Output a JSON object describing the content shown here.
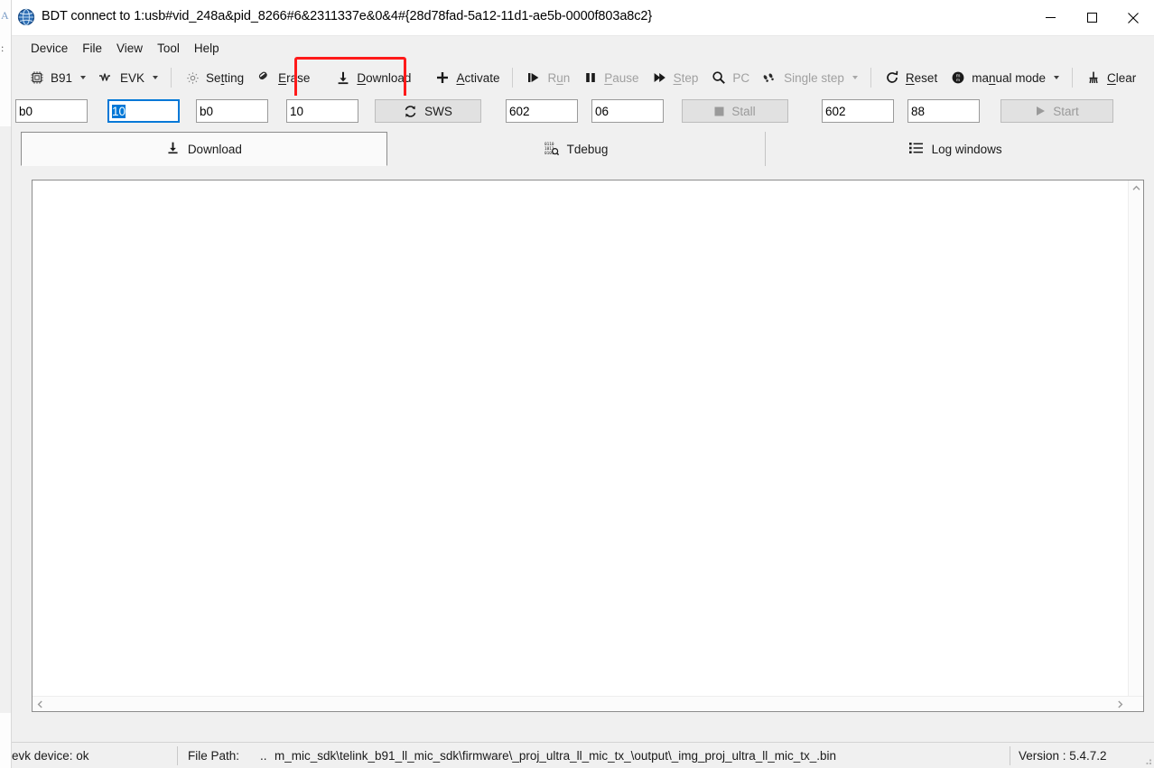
{
  "window": {
    "title": "BDT connect to 1:usb#vid_248a&pid_8266#6&2311337e&0&4#{28d78fad-5a12-11d1-ae5b-0000f803a8c2}",
    "app_icon": "globe-icon",
    "controls": {
      "minimize": "minimize-icon",
      "maximize": "maximize-icon",
      "close": "close-icon"
    }
  },
  "menubar": {
    "items": [
      {
        "label": "Device"
      },
      {
        "label": "File"
      },
      {
        "label": "View"
      },
      {
        "label": "Tool"
      },
      {
        "label": "Help"
      }
    ]
  },
  "toolbar": {
    "items": [
      {
        "label": "B91",
        "icon": "chip-icon",
        "dropdown": true,
        "disabled": false
      },
      {
        "label": "EVK",
        "icon": "waveform-icon",
        "dropdown": true,
        "disabled": false
      },
      {
        "label": "Setting",
        "icon": "gear-icon",
        "dropdown": false,
        "disabled": false
      },
      {
        "label": "Erase",
        "icon": "eraser-icon",
        "dropdown": false,
        "disabled": false
      },
      {
        "label": "Download",
        "icon": "download-icon",
        "dropdown": false,
        "disabled": false
      },
      {
        "label": "Activate",
        "icon": "plus-icon",
        "dropdown": false,
        "disabled": false
      },
      {
        "label": "Run",
        "icon": "run-icon",
        "dropdown": false,
        "disabled": true
      },
      {
        "label": "Pause",
        "icon": "pause-icon",
        "dropdown": false,
        "disabled": true
      },
      {
        "label": "Step",
        "icon": "step-icon",
        "dropdown": false,
        "disabled": true
      },
      {
        "label": "PC",
        "icon": "search-icon",
        "dropdown": false,
        "disabled": true
      },
      {
        "label": "Single step",
        "icon": "footsteps-icon",
        "dropdown": true,
        "disabled": true
      },
      {
        "label": "Reset",
        "icon": "reset-icon",
        "dropdown": false,
        "disabled": false
      },
      {
        "label": "manual mode",
        "icon": "mode-icon",
        "dropdown": true,
        "disabled": false
      },
      {
        "label": "Clear",
        "icon": "clear-icon",
        "dropdown": false,
        "disabled": false
      }
    ],
    "highlight": {
      "target": "Download",
      "color": "#ff1a1a"
    }
  },
  "fields": {
    "addr1": {
      "value": "b0",
      "focused": false
    },
    "len1": {
      "value": "10",
      "focused": true,
      "selected": true
    },
    "addr2": {
      "value": "b0",
      "focused": false
    },
    "len2": {
      "value": "10",
      "focused": false
    },
    "sws_button": {
      "label": "SWS",
      "icon": "refresh-icon",
      "disabled": false
    },
    "addr3": {
      "value": "602",
      "focused": false
    },
    "val3": {
      "value": "06",
      "focused": false
    },
    "stall_button": {
      "label": "Stall",
      "icon": "stop-icon",
      "disabled": true
    },
    "addr4": {
      "value": "602",
      "focused": false
    },
    "val4": {
      "value": "88",
      "focused": false
    },
    "start_button": {
      "label": "Start",
      "icon": "play-icon",
      "disabled": true
    }
  },
  "tabs": [
    {
      "label": "Download",
      "icon": "download-icon",
      "selected": true
    },
    {
      "label": "Tdebug",
      "icon": "binary-icon",
      "selected": false
    },
    {
      "label": "Log windows",
      "icon": "list-icon",
      "selected": false
    }
  ],
  "content": {
    "text": "",
    "vertical_scrollbar": {
      "up": "chevron-up-icon",
      "down": "chevron-down-icon"
    },
    "horizontal_scrollbar": {
      "left": "chevron-left-icon",
      "right": "chevron-right-icon"
    }
  },
  "statusbar": {
    "device_status": "evk device: ok",
    "file_path_label": "File Path:",
    "file_path_prefix": "..",
    "file_path": "m_mic_sdk\\telink_b91_ll_mic_sdk\\firmware\\_proj_ultra_ll_mic_tx_\\output\\_img_proj_ultra_ll_mic_tx_.bin",
    "version": "Version : 5.4.7.2"
  }
}
